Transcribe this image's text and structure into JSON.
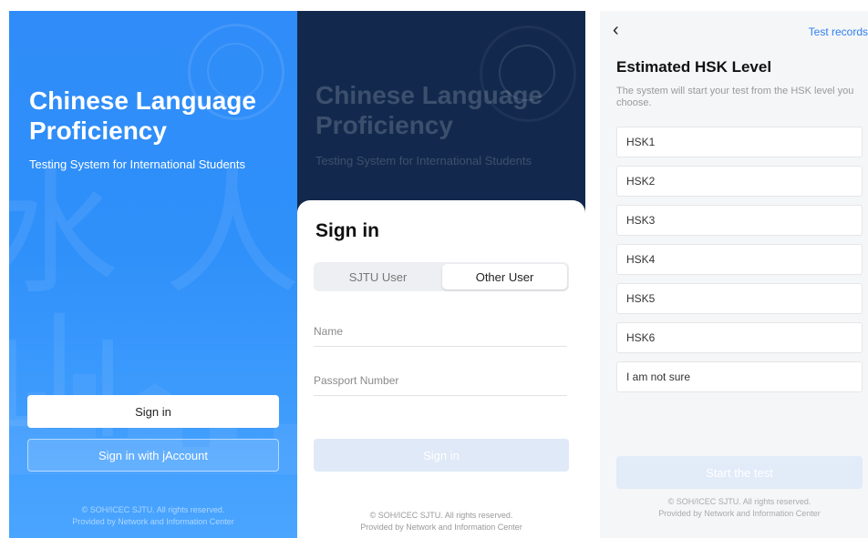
{
  "welcome": {
    "title_line1": "Chinese Language",
    "title_line2": "Proficiency",
    "subtitle": "Testing System for International Students",
    "sign_in_label": "Sign in",
    "jaccount_label": "Sign in with jAccount",
    "footer_line1": "© SOH/ICEC SJTU. All rights reserved.",
    "footer_line2": "Provided by Network and Information Center",
    "bg_char_1": "水",
    "bg_char_2": "人",
    "bg_char_3": "山",
    "colors": {
      "background": "#2f8cf8",
      "text": "#ffffff"
    }
  },
  "signin": {
    "bg_title_line1": "Chinese Language",
    "bg_title_line2": "Proficiency",
    "bg_subtitle": "Testing System for International Students",
    "title": "Sign in",
    "tabs": [
      {
        "label": "SJTU User",
        "selected": false
      },
      {
        "label": "Other User",
        "selected": true
      }
    ],
    "name_placeholder": "Name",
    "passport_placeholder": "Passport Number",
    "submit_label": "Sign in",
    "footer_line1": "© SOH/ICEC SJTU. All rights reserved.",
    "footer_line2": "Provided by Network and Information Center",
    "colors": {
      "backdrop": "#12294d",
      "button_disabled": "#dfe9f7"
    }
  },
  "hsk": {
    "back_icon": "chevron-left",
    "back_glyph": "‹",
    "records_label": "Test records",
    "title": "Estimated HSK Level",
    "description": "The system will start your test from the HSK level you choose.",
    "options": [
      "HSK1",
      "HSK2",
      "HSK3",
      "HSK4",
      "HSK5",
      "HSK6",
      "I am not sure"
    ],
    "start_label": "Start the test",
    "footer_line1": "© SOH/ICEC SJTU. All rights reserved.",
    "footer_line2": "Provided by Network and Information Center",
    "colors": {
      "accent": "#2f80ed",
      "button_disabled": "#e2ebf8"
    }
  }
}
